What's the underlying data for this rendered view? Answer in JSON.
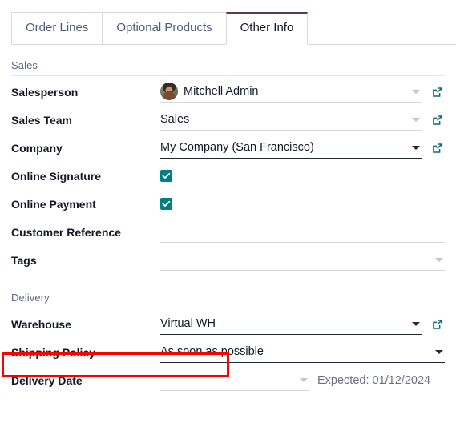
{
  "tabs": [
    {
      "label": "Order Lines",
      "active": false
    },
    {
      "label": "Optional Products",
      "active": false
    },
    {
      "label": "Other Info",
      "active": true
    }
  ],
  "sections": {
    "sales": {
      "title": "Sales",
      "fields": {
        "salesperson": {
          "label": "Salesperson",
          "value": "Mitchell Admin"
        },
        "sales_team": {
          "label": "Sales Team",
          "value": "Sales"
        },
        "company": {
          "label": "Company",
          "value": "My Company (San Francisco)"
        },
        "online_signature": {
          "label": "Online Signature",
          "checked": "true"
        },
        "online_payment": {
          "label": "Online Payment",
          "checked": "true"
        },
        "customer_reference": {
          "label": "Customer Reference",
          "value": ""
        },
        "tags": {
          "label": "Tags",
          "value": ""
        }
      }
    },
    "delivery": {
      "title": "Delivery",
      "fields": {
        "warehouse": {
          "label": "Warehouse",
          "value": "Virtual WH"
        },
        "shipping_policy": {
          "label": "Shipping Policy",
          "value": "As soon as possible"
        },
        "delivery_date": {
          "label": "Delivery Date",
          "value": "",
          "expected": "Expected: 01/12/2024"
        }
      }
    }
  },
  "icons": {
    "external_link": "external-link-icon",
    "dropdown_caret": "chevron-down-icon",
    "checkmark": "check-icon"
  },
  "colors": {
    "accent_teal": "#017e84",
    "active_tab_underline": "#5c3b52",
    "highlight_red": "#ff0000",
    "label_text": "#111827",
    "section_title": "#5c6a86",
    "muted_text": "#6b7280"
  },
  "annotations": {
    "warehouse_highlight": {
      "name": "warehouse-highlight-box"
    }
  }
}
